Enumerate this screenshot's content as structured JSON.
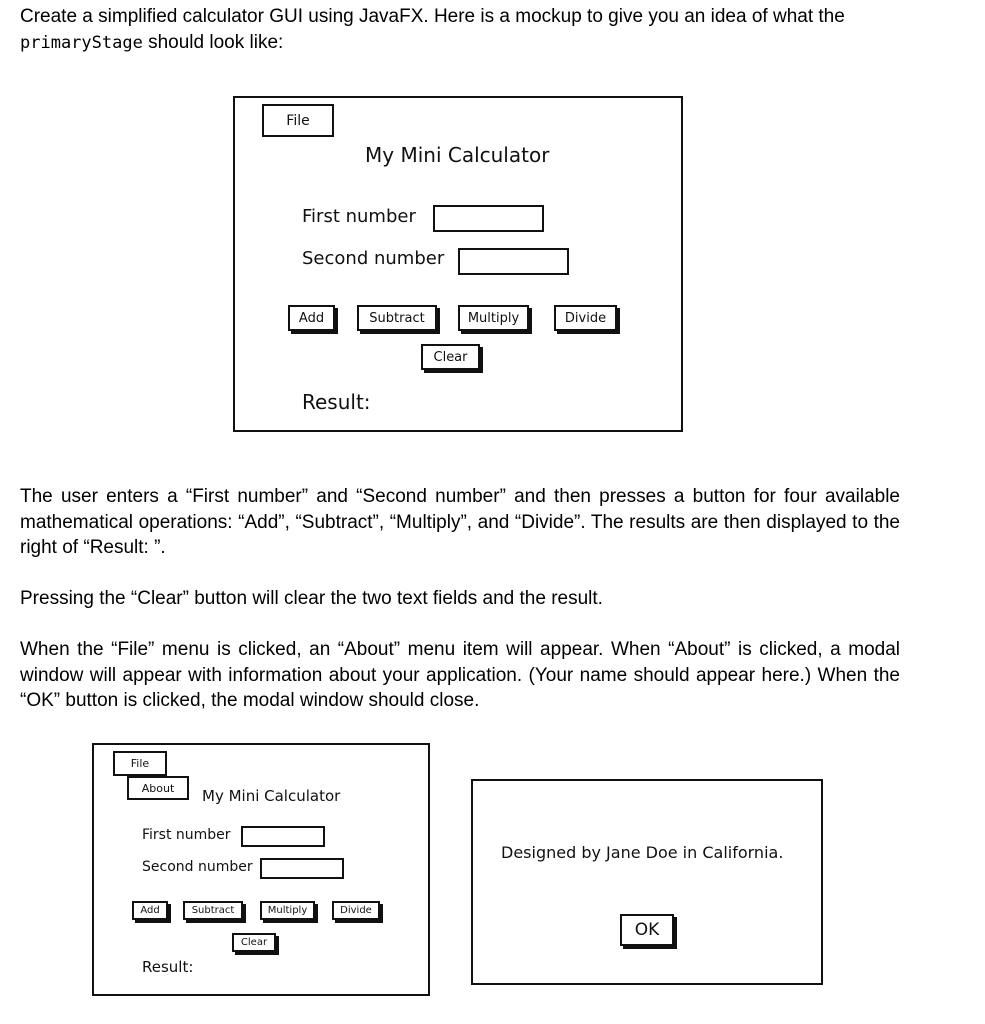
{
  "intro": {
    "text_before": "Create a simplified calculator GUI using JavaFX. Here is a mockup to give you an idea of what the",
    "code": "primaryStage",
    "text_after": " should look like:"
  },
  "mockup_main": {
    "menu_file": "File",
    "title": "My Mini Calculator",
    "first_label": "First number",
    "second_label": "Second number",
    "first_value": "",
    "second_value": "",
    "buttons": [
      "Add",
      "Subtract",
      "Multiply",
      "Divide"
    ],
    "clear": "Clear",
    "result_label": "Result:"
  },
  "paragraphs": [
    "The user enters a “First number” and “Second number” and then presses a button for four available mathematical operations: “Add”, “Subtract”, “Multiply”, and “Divide”. The results are then displayed to the right of “Result: ”.",
    "Pressing the “Clear” button will clear the two text fields and the result.",
    "When the “File” menu is clicked, an “About” menu item will appear. When “About” is clicked, a modal window will appear with information about your application. (Your name should appear here.) When the “OK” button is clicked, the modal window should close."
  ],
  "mockup_menu": {
    "menu_file": "File",
    "menu_about": "About",
    "title": "My Mini Calculator",
    "first_label": "First number",
    "second_label": "Second number",
    "buttons": [
      "Add",
      "Subtract",
      "Multiply",
      "Divide"
    ],
    "clear": "Clear",
    "result_label": "Result:"
  },
  "mockup_modal": {
    "message": "Designed by Jane Doe in California.",
    "ok": "OK"
  }
}
